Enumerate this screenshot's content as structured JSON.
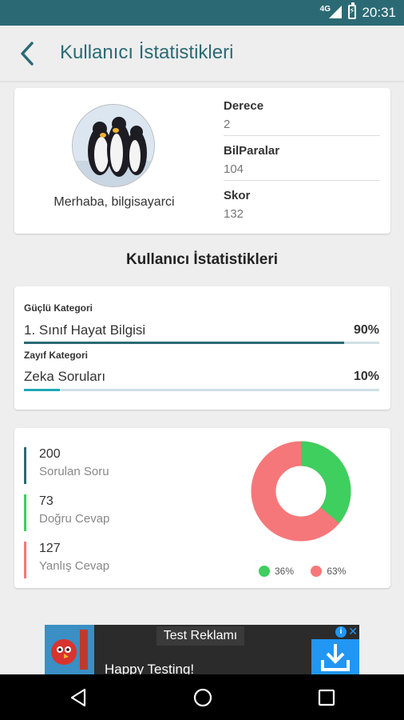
{
  "status_bar": {
    "network": "4G",
    "time": "20:31"
  },
  "header": {
    "title": "Kullanıcı İstatistikleri"
  },
  "profile": {
    "greeting": "Merhaba, bilgisayarci",
    "stats": [
      {
        "label": "Derece",
        "value": "2"
      },
      {
        "label": "BilParalar",
        "value": "104"
      },
      {
        "label": "Skor",
        "value": "132"
      }
    ]
  },
  "section_title": "Kullanıcı İstatistikleri",
  "categories": {
    "strong": {
      "heading": "Güçlü Kategori",
      "name": "1. Sınıf Hayat Bilgisi",
      "percent": "90%",
      "progress": 0.9
    },
    "weak": {
      "heading": "Zayıf Kategori",
      "name": "Zeka Soruları",
      "percent": "10%",
      "progress": 0.1
    }
  },
  "summary": {
    "items": [
      {
        "value": "200",
        "label": "Sorulan Soru",
        "color": "#2b6a74"
      },
      {
        "value": "73",
        "label": "Doğru Cevap",
        "color": "#3ecf5e"
      },
      {
        "value": "127",
        "label": "Yanlış Cevap",
        "color": "#f6777a"
      }
    ],
    "chart": {
      "correct_percent": 36,
      "wrong_percent": 63,
      "correct_label": "36%",
      "wrong_label": "63%",
      "correct_color": "#3ecf5e",
      "wrong_color": "#f6777a"
    }
  },
  "ad": {
    "title": "Test Reklamı",
    "text": "Happy Testing!"
  }
}
